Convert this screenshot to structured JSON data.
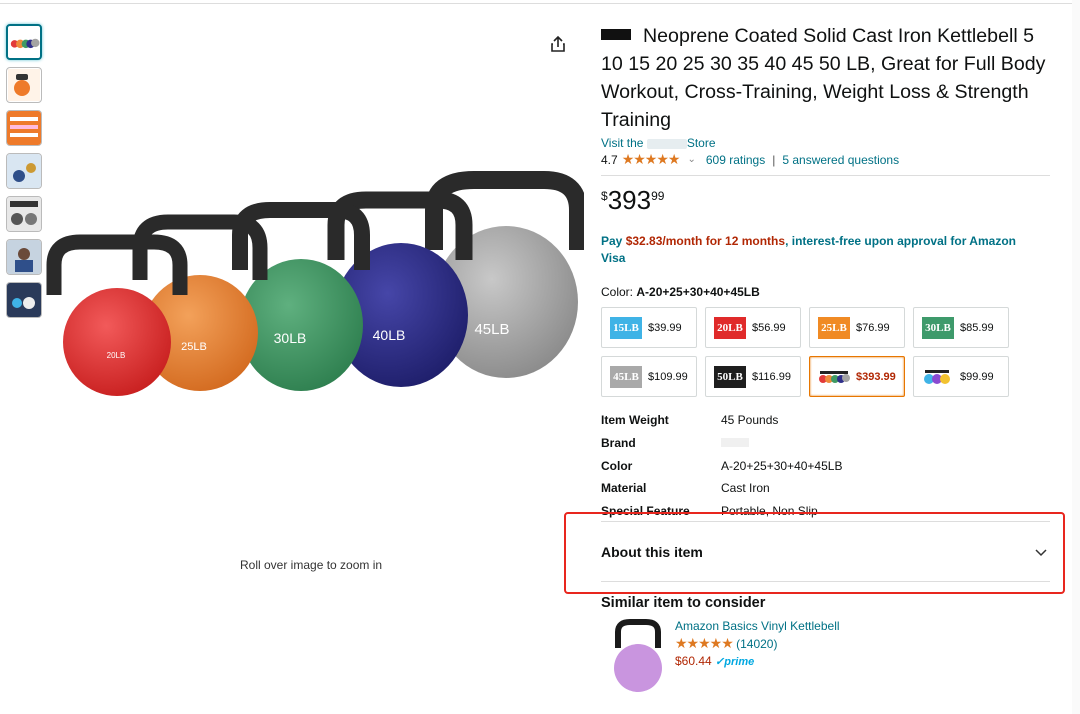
{
  "product": {
    "title": "Neoprene Coated Solid Cast Iron Kettlebell 5 10 15 20 25 30 35 40 45 50 LB, Great for Full Body Workout, Cross-Training, Weight Loss & Strength Training",
    "store_prefix": "Visit the",
    "store_suffix": "Store",
    "rating": "4.7",
    "stars": "★★★★★",
    "ratings_count": "609 ratings",
    "answered": "5 answered questions",
    "price": {
      "symbol": "$",
      "whole": "393",
      "fraction": "99"
    },
    "pay": {
      "prefix": "Pay ",
      "amount": "$32.83/month for 12 months",
      "suffix": ", interest-free upon approval for Amazon Visa"
    },
    "color_label": "Color:",
    "color_value": "A-20+25+30+40+45LB",
    "zoom_hint": "Roll over image to zoom in"
  },
  "swatches": [
    {
      "chip": "15LB",
      "color": "#3fb3e6",
      "price": "$39.99"
    },
    {
      "chip": "20LB",
      "color": "#e02a2a",
      "price": "$56.99"
    },
    {
      "chip": "25LB",
      "color": "#f08a24",
      "price": "$76.99"
    },
    {
      "chip": "30LB",
      "color": "#3e9a6b",
      "price": "$85.99"
    },
    {
      "chip": "45LB",
      "color": "#a9a9a9",
      "price": "$109.99"
    },
    {
      "chip": "50LB",
      "color": "#1e1e1e",
      "price": "$116.99"
    },
    {
      "chip": "",
      "color": "multi",
      "price": "$393.99"
    },
    {
      "chip": "",
      "color": "multi2",
      "price": "$99.99"
    }
  ],
  "specs": [
    {
      "k": "Item Weight",
      "v": "45 Pounds"
    },
    {
      "k": "Brand",
      "v": ""
    },
    {
      "k": "Color",
      "v": "A-20+25+30+40+45LB"
    },
    {
      "k": "Material",
      "v": "Cast Iron"
    },
    {
      "k": "Special Feature",
      "v": "Portable, Non Slip"
    }
  ],
  "about": {
    "label": "About this item"
  },
  "similar": {
    "heading": "Similar item to consider",
    "name": "Amazon Basics Vinyl Kettlebell",
    "stars": "★★★★★",
    "count": "(14020)",
    "price": "$60.44",
    "prime": "✓prime"
  },
  "kettlebells": [
    {
      "label": "20LB",
      "color": "#e23a3a"
    },
    {
      "label": "25LB",
      "color": "#ee8a3a"
    },
    {
      "label": "30LB",
      "color": "#3f9a63"
    },
    {
      "label": "40LB",
      "color": "#2f2f8a"
    },
    {
      "label": "45LB",
      "color": "#a3a3a3"
    }
  ]
}
